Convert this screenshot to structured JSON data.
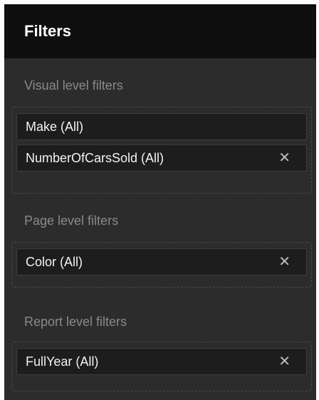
{
  "panel": {
    "title": "Filters"
  },
  "sections": [
    {
      "title": "Visual level filters",
      "cards": [
        {
          "label": "Make (All)",
          "removable": false
        },
        {
          "label": "NumberOfCarsSold (All)",
          "removable": true,
          "remove_glyph": "✕"
        }
      ]
    },
    {
      "title": "Page level filters",
      "cards": [
        {
          "label": "Color (All)",
          "removable": true,
          "remove_glyph": "✕"
        }
      ]
    },
    {
      "title": "Report level filters",
      "cards": [
        {
          "label": "FullYear (All)",
          "removable": true,
          "remove_glyph": "✕"
        }
      ]
    }
  ]
}
